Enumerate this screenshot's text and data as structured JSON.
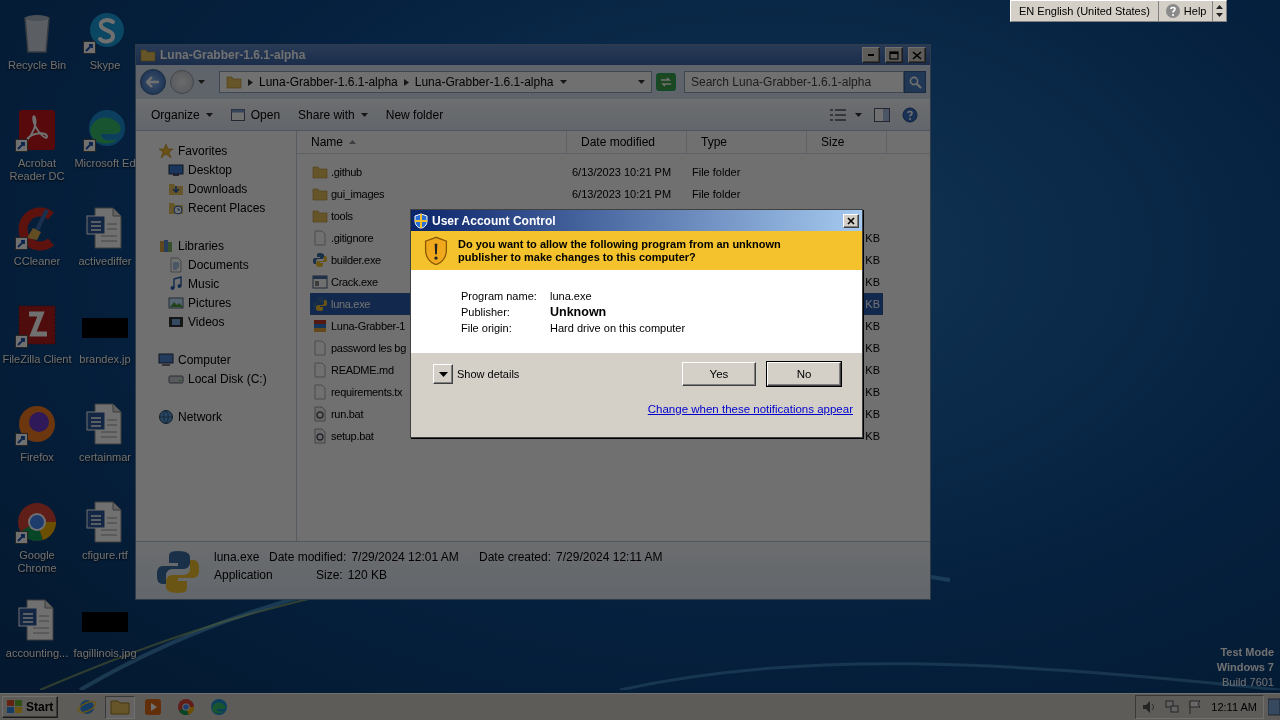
{
  "desktop_icons": [
    {
      "label": "Recycle Bin",
      "kind": "recycle",
      "shortcut": false
    },
    {
      "label": "Acrobat Reader DC",
      "kind": "acrobat",
      "shortcut": true
    },
    {
      "label": "CCleaner",
      "kind": "ccleaner",
      "shortcut": true
    },
    {
      "label": "FileZilla Client",
      "kind": "filezilla",
      "shortcut": true
    },
    {
      "label": "Firefox",
      "kind": "firefox",
      "shortcut": true
    },
    {
      "label": "Google Chrome",
      "kind": "chrome",
      "shortcut": true
    },
    {
      "label": "accounting...",
      "kind": "word",
      "shortcut": false
    },
    {
      "label": "Skype",
      "kind": "skype",
      "shortcut": true
    },
    {
      "label": "Microsoft Ed",
      "kind": "edge",
      "shortcut": true
    },
    {
      "label": "activediffer",
      "kind": "word",
      "shortcut": false
    },
    {
      "label": "brandex.jp",
      "kind": "image",
      "shortcut": false
    },
    {
      "label": "certainmar",
      "kind": "word",
      "shortcut": false
    },
    {
      "label": "cfigure.rtf",
      "kind": "word",
      "shortcut": false
    },
    {
      "label": "fagillinois.jpg",
      "kind": "image",
      "shortcut": false
    }
  ],
  "language_bar": {
    "language": "EN English (United States)",
    "help": "Help"
  },
  "explorer": {
    "title": "Luna-Grabber-1.6.1-alpha",
    "breadcrumb": [
      "Luna-Grabber-1.6.1-alpha",
      "Luna-Grabber-1.6.1-alpha"
    ],
    "search": {
      "placeholder": "Search Luna-Grabber-1.6.1-alpha"
    },
    "toolbar": [
      {
        "label": "Organize",
        "kind": "menu"
      },
      {
        "label": "Open",
        "kind": "open"
      },
      {
        "label": "Share with",
        "kind": "menu"
      },
      {
        "label": "New folder",
        "kind": "plain"
      }
    ],
    "nav": [
      {
        "label": "Favorites",
        "kind": "favorites",
        "children": [
          {
            "label": "Desktop",
            "kind": "desktop"
          },
          {
            "label": "Downloads",
            "kind": "downloads"
          },
          {
            "label": "Recent Places",
            "kind": "recent"
          }
        ]
      },
      {
        "label": "Libraries",
        "kind": "libraries",
        "children": [
          {
            "label": "Documents",
            "kind": "documents"
          },
          {
            "label": "Music",
            "kind": "music"
          },
          {
            "label": "Pictures",
            "kind": "pictures"
          },
          {
            "label": "Videos",
            "kind": "videos"
          }
        ]
      },
      {
        "label": "Computer",
        "kind": "computer",
        "children": [
          {
            "label": "Local Disk (C:)",
            "kind": "disk"
          }
        ]
      },
      {
        "label": "Network",
        "kind": "network"
      }
    ],
    "columns": [
      "Name",
      "Date modified",
      "Type",
      "Size"
    ],
    "rows": [
      {
        "name": ".github",
        "date": "6/13/2023 10:21 PM",
        "type": "File folder",
        "kind": "folder",
        "selected": false
      },
      {
        "name": "gui_images",
        "date": "6/13/2023 10:21 PM",
        "type": "File folder",
        "kind": "folder",
        "selected": false
      },
      {
        "name": "tools",
        "kind": "folder",
        "selected": false
      },
      {
        "name": ".gitignore",
        "size": "KB",
        "kind": "file",
        "selected": false
      },
      {
        "name": "builder.exe",
        "size": "KB",
        "kind": "python",
        "selected": false
      },
      {
        "name": "Crack.exe",
        "size": "KB",
        "kind": "window",
        "selected": false
      },
      {
        "name": "luna.exe",
        "size": "KB",
        "kind": "python",
        "selected": true
      },
      {
        "name": "Luna-Grabber-1",
        "size": "KB",
        "kind": "archive",
        "selected": false
      },
      {
        "name": "password les bg",
        "size": "KB",
        "kind": "file",
        "selected": false
      },
      {
        "name": "README.md",
        "size": "KB",
        "kind": "file",
        "selected": false
      },
      {
        "name": "requirements.tx",
        "size": "KB",
        "kind": "file",
        "selected": false
      },
      {
        "name": "run.bat",
        "size": "KB",
        "kind": "bat",
        "selected": false
      },
      {
        "name": "setup.bat",
        "size": "KB",
        "kind": "bat",
        "selected": false
      }
    ],
    "details": {
      "name": "luna.exe",
      "type": "Application",
      "fields": [
        {
          "label": "Date modified:",
          "value": "7/29/2024 12:01 AM"
        },
        {
          "label": "Date created:",
          "value": "7/29/2024 12:11 AM"
        },
        {
          "label": "Size:",
          "value": "120 KB"
        }
      ]
    }
  },
  "uac": {
    "title": "User Account Control",
    "question": "Do you want to allow the following program from an unknown publisher to make changes to this computer?",
    "fields": [
      {
        "label": "Program name:",
        "value": "luna.exe",
        "kind": "plain"
      },
      {
        "label": "Publisher:",
        "value": "Unknown",
        "kind": "bold"
      },
      {
        "label": "File origin:",
        "value": "Hard drive on this computer",
        "kind": "plain"
      }
    ],
    "details_toggle": "Show details",
    "buttons": [
      {
        "label": "Yes",
        "default": false
      },
      {
        "label": "No",
        "default": true
      }
    ],
    "link": "Change when these notifications appear"
  },
  "taskbar": {
    "start": "Start",
    "apps": [
      {
        "kind": "ie",
        "active": false
      },
      {
        "kind": "explorer",
        "active": true
      },
      {
        "kind": "media",
        "active": false
      },
      {
        "kind": "chrome",
        "active": false
      },
      {
        "kind": "edge",
        "active": false
      }
    ],
    "clock": "12:11 AM"
  },
  "build_info": [
    "Test Mode",
    "Windows 7",
    "Build 7601"
  ]
}
